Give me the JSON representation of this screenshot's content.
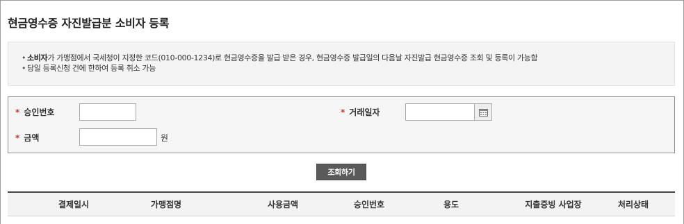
{
  "page": {
    "title": "현금영수증 자진발급분 소비자 등록"
  },
  "notice": {
    "line1_bold": "소비자",
    "line1_rest": "가 가맹점에서 국세청이 지정한 코드(010-000-1234)로 현금영수증을 발급 받은 경우, 현금영수증 발급일의 다음날 자진발급 현금영수증 조회 및 등록이 가능함",
    "line2": "당일 등록신청 건에 한하여 등록 취소 가능",
    "bullet": "•"
  },
  "form": {
    "required_mark": "*",
    "approval_number": {
      "label": "승인번호",
      "value": ""
    },
    "transaction_date": {
      "label": "거래일자",
      "value": ""
    },
    "amount": {
      "label": "금액",
      "value": "",
      "unit": "원"
    }
  },
  "search_button": {
    "label": "조회하기"
  },
  "table": {
    "columns": [
      "결제일시",
      "가맹점명",
      "사용금액",
      "승인번호",
      "용도",
      "지출증빙 사업장",
      "처리상태"
    ]
  },
  "colors": {
    "required": "#c0392b",
    "button_bg": "#5a5a5a",
    "panel_bg": "#f4f4f4"
  }
}
